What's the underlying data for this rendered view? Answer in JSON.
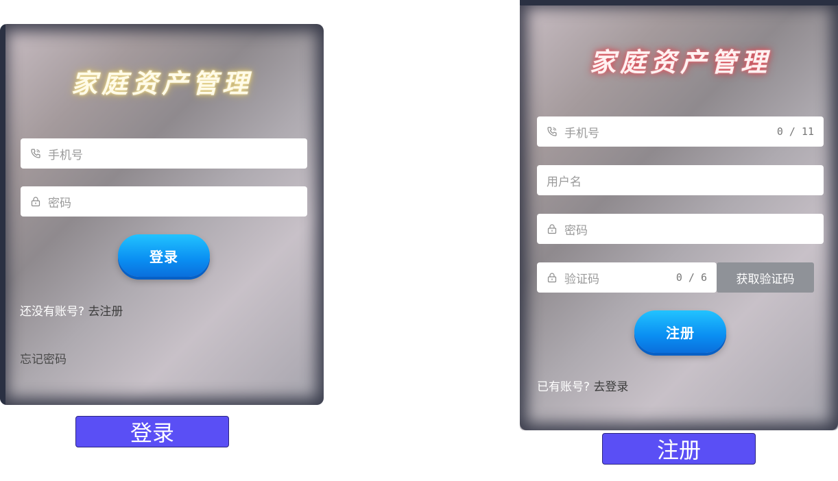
{
  "login": {
    "title": "家庭资产管理",
    "phone_placeholder": "手机号",
    "password_placeholder": "密码",
    "submit_label": "登录",
    "register_prompt": "还没有账号?",
    "register_link": "去注册",
    "forgot_link": "忘记密码",
    "caption": "登录"
  },
  "register": {
    "title": "家庭资产管理",
    "phone_placeholder": "手机号",
    "phone_counter": "0 / 11",
    "username_placeholder": "用户名",
    "password_placeholder": "密码",
    "code_placeholder": "验证码",
    "code_counter": "0 / 6",
    "get_code_label": "获取验证码",
    "submit_label": "注册",
    "login_prompt": "已有账号?",
    "login_link": "去登录",
    "caption": "注册"
  },
  "icons": {
    "phone": "phone-icon",
    "lock": "lock-icon"
  },
  "colors": {
    "button_gradient_top": "#22c3ff",
    "button_gradient_bottom": "#0a6fdc",
    "caption_bg": "#5a4ff5",
    "title_glow_login": "#e9d690",
    "title_glow_register": "#e0606a",
    "code_button_bg": "#8f9298"
  }
}
